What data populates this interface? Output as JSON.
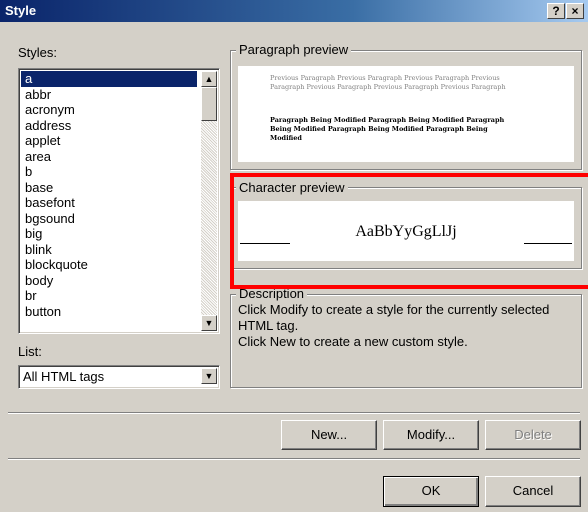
{
  "window": {
    "title": "Style",
    "help_label": "?",
    "close_label": "×"
  },
  "styles": {
    "label": "Styles:",
    "items": [
      "a",
      "abbr",
      "acronym",
      "address",
      "applet",
      "area",
      "b",
      "base",
      "basefont",
      "bgsound",
      "big",
      "blink",
      "blockquote",
      "body",
      "br",
      "button"
    ],
    "selected": "a"
  },
  "list": {
    "label": "List:",
    "value": "All HTML tags"
  },
  "paragraph_preview": {
    "title": "Paragraph preview",
    "previous_text": "Previous Paragraph Previous Paragraph Previous Paragraph Previous Paragraph Previous Paragraph Previous Paragraph Previous Paragraph",
    "modified_text": "Paragraph Being Modified Paragraph Being Modified Paragraph Being Modified Paragraph Being Modified Paragraph Being Modified"
  },
  "character_preview": {
    "title": "Character preview",
    "sample": "AaBbYyGgLlJj"
  },
  "description": {
    "title": "Description",
    "text": "Click Modify to create a style for the currently selected HTML tag.\nClick New to create a new custom style."
  },
  "buttons": {
    "new": "New...",
    "modify": "Modify...",
    "delete": "Delete",
    "ok": "OK",
    "cancel": "Cancel"
  },
  "colors": {
    "highlight": "#f00",
    "selection": "#0a246a"
  }
}
